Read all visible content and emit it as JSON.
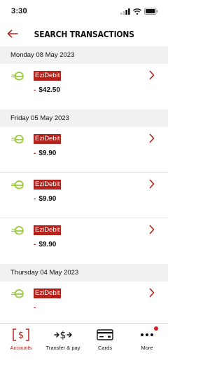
{
  "status": {
    "time": "3:30"
  },
  "header": {
    "title": "SEARCH TRANSACTIONS"
  },
  "colors": {
    "accent": "#b3231b",
    "logo_green": "#9acb3c",
    "section_bg": "#f1f1f1",
    "badge": "#d71f26"
  },
  "groups": [
    {
      "date": "Monday 08 May 2023",
      "transactions": [
        {
          "merchant": "EziDebit",
          "sign": "-",
          "amount": "$42.50",
          "icon": "ezidebit-logo"
        }
      ]
    },
    {
      "date": "Friday 05 May 2023",
      "transactions": [
        {
          "merchant": "EziDebit",
          "sign": "-",
          "amount": "$9.90",
          "icon": "ezidebit-logo"
        },
        {
          "merchant": "EziDebit",
          "sign": "-",
          "amount": "$9.90",
          "icon": "ezidebit-logo"
        },
        {
          "merchant": "EziDebit",
          "sign": "-",
          "amount": "$9.90",
          "icon": "ezidebit-logo"
        }
      ]
    },
    {
      "date": "Thursday 04 May 2023",
      "transactions": [
        {
          "merchant": "EziDebit",
          "sign": "-",
          "amount": "",
          "icon": "ezidebit-logo"
        }
      ]
    }
  ],
  "tabs": [
    {
      "label": "Accounts",
      "icon": "accounts-dollar-icon",
      "active": true
    },
    {
      "label": "Transfer & pay",
      "icon": "transfer-arrows-icon",
      "active": false
    },
    {
      "label": "Cards",
      "icon": "card-icon",
      "active": false
    },
    {
      "label": "More",
      "icon": "more-dots-icon",
      "active": false,
      "badge": true
    }
  ]
}
